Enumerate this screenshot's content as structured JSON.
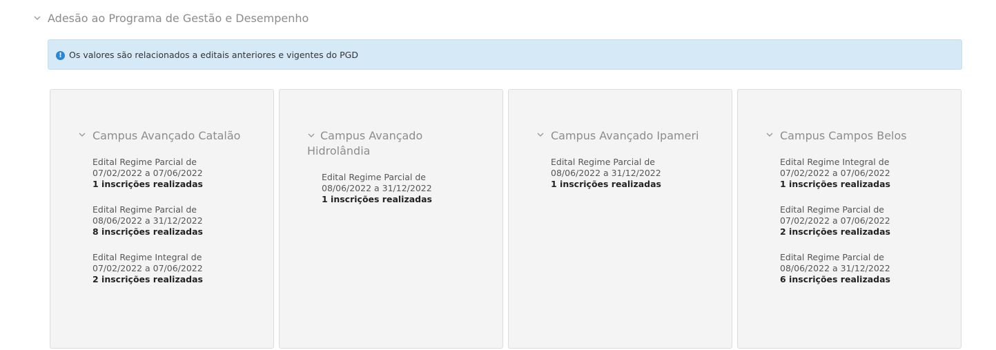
{
  "section": {
    "title": "Adesão ao Programa de Gestão e Desempenho",
    "icon": "chevron-down-icon"
  },
  "info": {
    "icon": "info-circle-icon",
    "text": "Os valores são relacionados a editais anteriores e vigentes do PGD"
  },
  "campuses": [
    {
      "title": "Campus Avançado Catalão",
      "editais": [
        {
          "name": "Edital Regime Parcial de 07/02/2022 a 07/06/2022",
          "count": "1 inscrições realizadas"
        },
        {
          "name": "Edital Regime Parcial de 08/06/2022 a 31/12/2022",
          "count": "8 inscrições realizadas"
        },
        {
          "name": "Edital Regime Integral de 07/02/2022 a 07/06/2022",
          "count": "2 inscrições realizadas"
        }
      ]
    },
    {
      "title": "Campus Avançado Hidrolândia",
      "editais": [
        {
          "name": "Edital Regime Parcial de 08/06/2022 a 31/12/2022",
          "count": "1 inscrições realizadas"
        }
      ]
    },
    {
      "title": "Campus Avançado Ipameri",
      "editais": [
        {
          "name": "Edital Regime Parcial de 08/06/2022 a 31/12/2022",
          "count": "1 inscrições realizadas"
        }
      ]
    },
    {
      "title": "Campus Campos Belos",
      "editais": [
        {
          "name": "Edital Regime Integral de 07/02/2022 a 07/06/2022",
          "count": "1 inscrições realizadas"
        },
        {
          "name": "Edital Regime Parcial de 07/02/2022 a 07/06/2022",
          "count": "2 inscrições realizadas"
        },
        {
          "name": "Edital Regime Parcial de 08/06/2022 a 31/12/2022",
          "count": "6 inscrições realizadas"
        }
      ]
    }
  ],
  "colors": {
    "info_bg": "#d6e9f6",
    "info_icon": "#2c86d1",
    "card_bg": "#f4f4f4",
    "muted_title": "#8c8c8c"
  }
}
